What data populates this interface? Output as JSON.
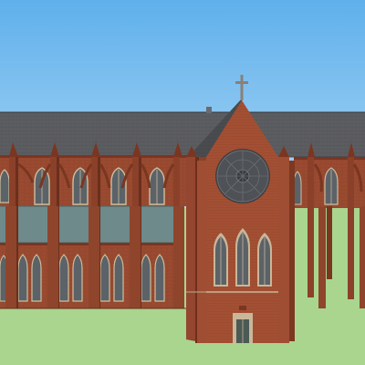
{
  "scene": {
    "subject": "gothic-cathedral-3d-model",
    "colors": {
      "sky_top": "#5fb0ec",
      "sky_bottom": "#dcefff",
      "ground": "#a9d58e",
      "brick": "#9a4a30",
      "brick_dark": "#7a3620",
      "brick_light": "#b8603f",
      "roof": "#5c5d61",
      "roof_dark": "#45464a",
      "stone": "#c9b79a",
      "glass": "#5b6268",
      "aisle_glass": "#6e8a8a",
      "rose_window": "#4e5256"
    },
    "icons": [
      "cross-icon",
      "rose-window-icon"
    ]
  }
}
